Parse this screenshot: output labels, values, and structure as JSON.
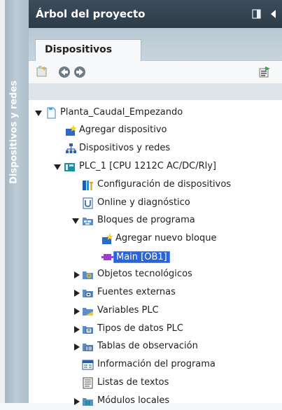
{
  "sidebar": {
    "vertical_tab_label": "Dispositivos y redes"
  },
  "panel": {
    "title": "Árbol del proyecto",
    "pin_icon": "pin-icon",
    "collapse_icon": "collapse-arrow-icon"
  },
  "tabs": {
    "active_label": "Dispositivos"
  },
  "toolbar": {
    "icons": [
      "new-group-icon",
      "back-icon",
      "forward-icon",
      "update-icon"
    ]
  },
  "tree": {
    "items": [
      {
        "label": "Planta_Caudal_Empezando",
        "icon": "project-icon",
        "expander": "expanded"
      },
      {
        "label": "Agregar dispositivo",
        "icon": "add-device-icon",
        "expander": "none"
      },
      {
        "label": "Dispositivos y redes",
        "icon": "network-icon",
        "expander": "none"
      },
      {
        "label": "PLC_1 [CPU 1212C AC/DC/Rly]",
        "icon": "plc-icon",
        "expander": "expanded"
      },
      {
        "label": "Configuración de dispositivos",
        "icon": "device-config-icon",
        "expander": "none"
      },
      {
        "label": "Online y diagnóstico",
        "icon": "diagnostics-icon",
        "expander": "none"
      },
      {
        "label": "Bloques de programa",
        "icon": "folder-icon",
        "expander": "expanded"
      },
      {
        "label": "Agregar nuevo bloque",
        "icon": "add-block-icon",
        "expander": "none"
      },
      {
        "label": "Main [OB1]",
        "icon": "ob-block-icon",
        "expander": "none",
        "selected": true
      },
      {
        "label": "Objetos tecnológicos",
        "icon": "tech-objects-icon",
        "expander": "collapsed"
      },
      {
        "label": "Fuentes externas",
        "icon": "external-sources-icon",
        "expander": "collapsed"
      },
      {
        "label": "Variables PLC",
        "icon": "plc-tags-icon",
        "expander": "collapsed"
      },
      {
        "label": "Tipos de datos PLC",
        "icon": "plc-datatypes-icon",
        "expander": "collapsed"
      },
      {
        "label": "Tablas de observación",
        "icon": "watch-tables-icon",
        "expander": "collapsed"
      },
      {
        "label": "Información del programa",
        "icon": "program-info-icon",
        "expander": "none"
      },
      {
        "label": "Listas de textos",
        "icon": "text-lists-icon",
        "expander": "none"
      },
      {
        "label": "Módulos locales",
        "icon": "local-modules-icon",
        "expander": "collapsed"
      }
    ]
  }
}
